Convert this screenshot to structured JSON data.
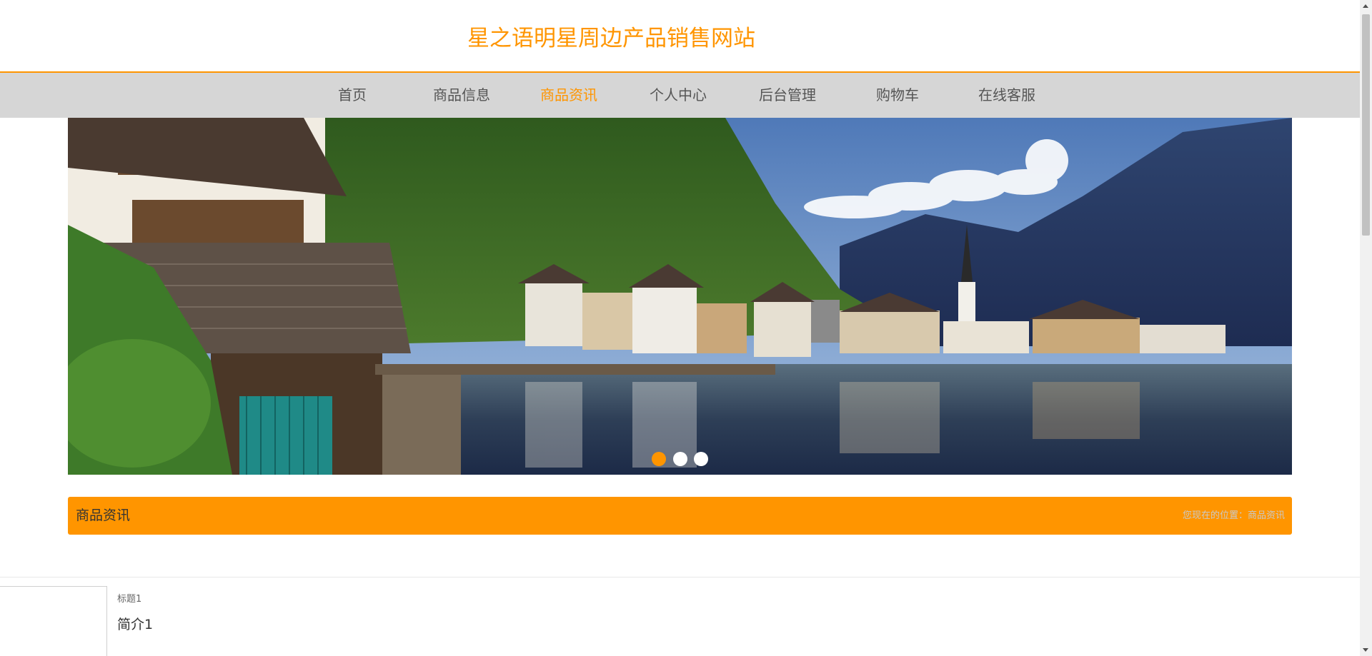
{
  "header": {
    "site_title": "星之语明星周边产品销售网站"
  },
  "nav": {
    "items": [
      {
        "label": "首页"
      },
      {
        "label": "商品信息"
      },
      {
        "label": "商品资讯"
      },
      {
        "label": "个人中心"
      },
      {
        "label": "后台管理"
      },
      {
        "label": "购物车"
      },
      {
        "label": "在线客服"
      }
    ],
    "active_index": 2
  },
  "banner": {
    "slide_count": 3,
    "active_slide": 1
  },
  "section": {
    "title": "商品资讯",
    "breadcrumb_prefix": "您现在的位置：",
    "breadcrumb_current": "商品资讯"
  },
  "news": [
    {
      "title": "标题1",
      "intro": "简介1"
    }
  ],
  "colors": {
    "accent": "#ff9500",
    "nav_bg": "#d6d6d6",
    "nav_text": "#555555"
  }
}
